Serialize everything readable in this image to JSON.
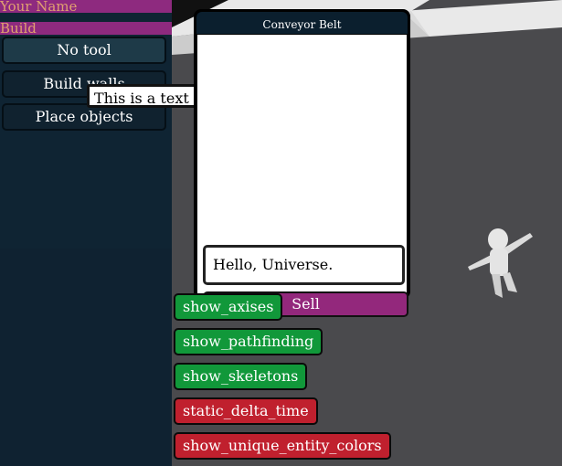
{
  "left_panel": {
    "name_bar": "Your Name",
    "build_bar": "Build",
    "tools": [
      {
        "label": "No tool",
        "active": true
      },
      {
        "label": "Build walls",
        "active": false
      },
      {
        "label": "Place objects",
        "active": false
      }
    ]
  },
  "tooltip_textbox": {
    "value": "This is a text box."
  },
  "conveyor_window": {
    "title": "Conveyor Belt",
    "input_value": "Hello, Universe.",
    "sell_label": "Sell"
  },
  "debug_toggles": [
    {
      "label": "show_axises",
      "state": "on"
    },
    {
      "label": "show_pathfinding",
      "state": "on"
    },
    {
      "label": "show_skeletons",
      "state": "on"
    },
    {
      "label": "static_delta_time",
      "state": "off"
    },
    {
      "label": "show_unique_entity_colors",
      "state": "off"
    }
  ],
  "colors": {
    "toggle_on": "#11983a",
    "toggle_off": "#c0202e",
    "accent_magenta": "#93287c",
    "panel_bg": "#0f2433"
  }
}
